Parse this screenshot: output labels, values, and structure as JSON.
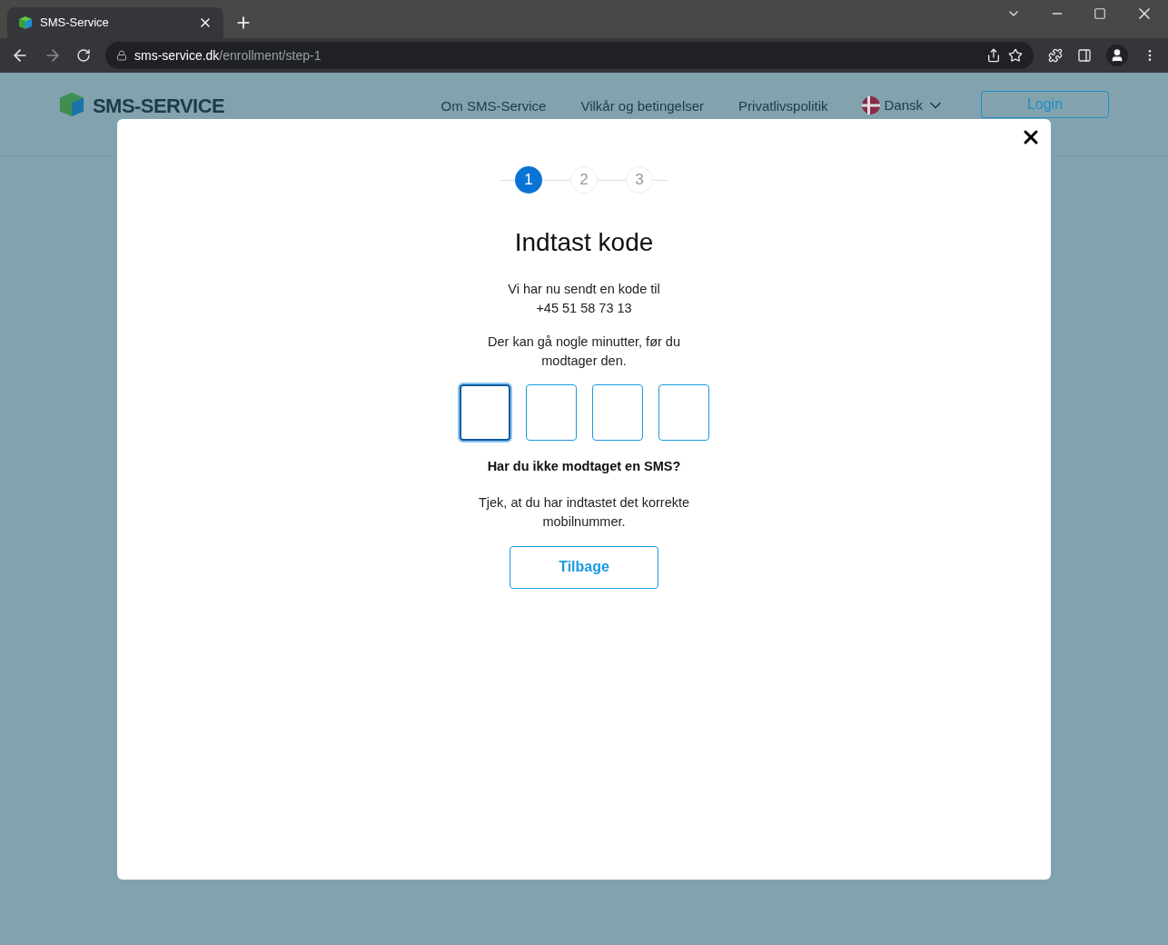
{
  "browser": {
    "tab_title": "SMS-Service",
    "url_host": "sms-service.dk",
    "url_path": "/enrollment/step-1"
  },
  "header": {
    "logo": "SMS-SERVICE",
    "nav": [
      "Om SMS-Service",
      "Vilkår og betingelser",
      "Privatlivspolitik"
    ],
    "language": "Dansk",
    "login": "Login"
  },
  "modal": {
    "steps": [
      {
        "label": "1",
        "selected": true
      },
      {
        "label": "2",
        "selected": false
      },
      {
        "label": "3",
        "selected": false
      }
    ],
    "title": "Indtast kode",
    "sent_line": "Vi har nu sendt en kode til",
    "phone": "+45 51 58 73 13",
    "wait_note": "Der kan gå nogle minutter, før du modtager den.",
    "code_boxes": [
      {
        "focused": true
      },
      {
        "focused": false
      },
      {
        "focused": false
      },
      {
        "focused": false
      }
    ],
    "help_title": "Har du ikke modtaget en SMS?",
    "help_text": "Tjek, at du har indtastet det korrekte mobilnummer.",
    "back": "Tilbage"
  }
}
